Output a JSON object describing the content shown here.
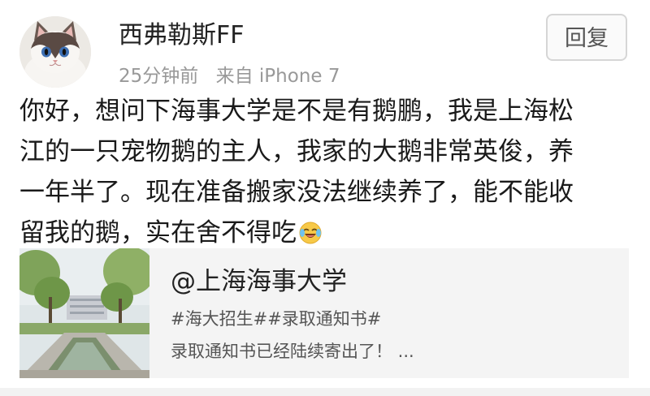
{
  "post": {
    "author": "西弗勒斯FF",
    "time": "25分钟前",
    "source": "来自 iPhone 7",
    "reply_label": "回复",
    "body_lines": [
      "你好，想问下海事大学是不是有鹅鹏，我是上海松",
      "江的一只宠物鹅的主人，我家的大鹅非常英俊，养",
      "一年半了。现在准备搬家没法继续养了，能不能收",
      "留我的鹅，实在舍不得吃"
    ],
    "emoji": "laughing-crying-emoji"
  },
  "card": {
    "title": "@上海海事大学",
    "tags": "#海大招生##录取通知书#",
    "desc": "录取通知书已经陆续寄出了！ ..."
  },
  "colors": {
    "username": "#222222",
    "meta": "#999999",
    "card_bg": "#f4f4f4",
    "reply_border": "#d6d6d6"
  }
}
